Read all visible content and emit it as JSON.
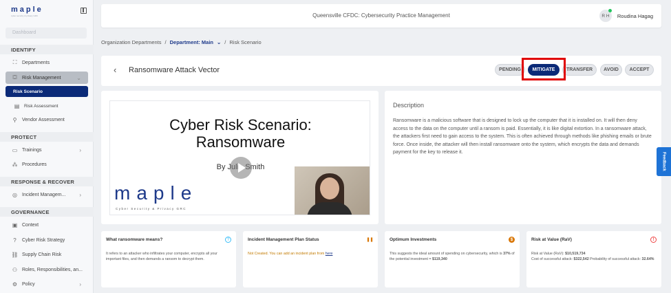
{
  "app": {
    "logo_word": "maple",
    "logo_sub": "cyber security & privacy GRC"
  },
  "sidebar": {
    "dashboard": "Dashboard",
    "sections": {
      "identify": "IDENTIFY",
      "protect": "PROTECT",
      "response": "RESPONSE & RECOVER",
      "governance": "GOVERNANCE"
    },
    "items": {
      "departments": "Departments",
      "risk_management": "Risk Management",
      "risk_scenario": "Risk Scenario",
      "risk_assessment": "Risk Assessment",
      "vendor_assessment": "Vendor Assessment",
      "trainings": "Trainings",
      "procedures": "Procedures",
      "incident_management": "Incident Managem...",
      "context": "Context",
      "cyber_risk_strategy": "Cyber Risk Strategy",
      "supply_chain_risk": "Supply Chain Risk",
      "roles": "Roles, Responsibilities, an...",
      "policy": "Policy"
    }
  },
  "header": {
    "title": "Queensville CFDC: Cybersecurity Practice Management",
    "avatar_initials": "R H",
    "user_name": "Roudina Hagag"
  },
  "breadcrumb": {
    "org": "Organization Departments",
    "sep1": "/",
    "dept": "Department: Main",
    "dept_chevron": "⌄",
    "sep2": "/",
    "current": "Risk Scenario"
  },
  "scenario": {
    "title": "Ransomware Attack Vector",
    "actions": {
      "pending": "PENDING",
      "mitigate": "MITIGATE",
      "transfer": "TRANSFER",
      "avoid": "AVOID",
      "accept": "ACCEPT"
    },
    "selected_action": "MITIGATE"
  },
  "video": {
    "slide_title_1": "Cyber Risk Scenario:",
    "slide_title_2": "Ransomware",
    "slide_author": "By Julia Smith",
    "slide_logo": "maple",
    "slide_tagline": "Cyber Security & Privacy GRC"
  },
  "description": {
    "title": "Description",
    "body": "Ransomware is a malicious software that is designed to lock up the computer that it is installed on. It will then deny access to the data on the computer until a ransom is paid. Essentially, it is like digital extortion. In a ransomware attack, the attackers first need to gain access to the system. This is often achieved through methods like phishing emails or brute force. Once inside, the attacker will then install ransomware onto the system, which encrypts the data and demands payment for the key to release it."
  },
  "feedback_label": "Feedback",
  "cards": {
    "what": {
      "title": "What ransomware means?",
      "body": "It refers to an attacker who infiltrates your computer, encrypts all your important files, and then demands a ransom to decrypt them."
    },
    "incident": {
      "title": "Incident Management Plan Status",
      "body": "Not Created. You can add an incident plan from",
      "link": "here"
    },
    "investments": {
      "title": "Optimum Investments",
      "body_a": "This suggests the ideal amount of spending on cybersecurity, which is",
      "pct": "37%",
      "body_b": "of the potential investment =",
      "amount": "$119,340"
    },
    "rav": {
      "title": "Risk at Value (RaV)",
      "rav_label": "Risk at Value (RaV):",
      "rav_value": "$10,519,734",
      "cost_label": "Cost of successful attack:",
      "cost_value": "$322,542",
      "prob_label": "Probability of successful attack:",
      "prob_value": "32.64%"
    }
  },
  "colors": {
    "brand": "#0b2a78",
    "highlight": "#e00000",
    "feedback": "#1e73d6"
  }
}
